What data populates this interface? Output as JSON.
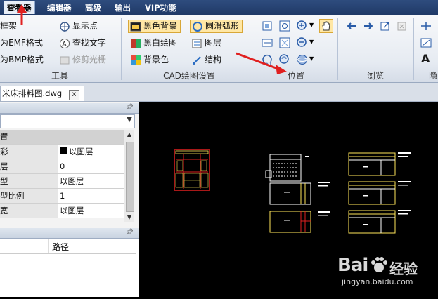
{
  "menu": {
    "items": [
      "查看器",
      "编辑器",
      "高级",
      "输出",
      "VIP功能"
    ]
  },
  "ribbon": {
    "tools": {
      "label": "工具",
      "frame": "框架",
      "emf": "为EMF格式",
      "bmp": "为BMP格式",
      "show_points": "显示点",
      "find_text": "查找文字",
      "trim_raster": "修剪光栅"
    },
    "cad_settings": {
      "label": "CAD绘图设置",
      "black_bg": "黑色背景",
      "smooth_arc": "圆滑弧形",
      "bw_drawing": "黑白绘图",
      "layers": "图层",
      "bg_color": "背景色",
      "structure": "结构"
    },
    "position": {
      "label": "位置"
    },
    "browse": {
      "label": "浏览"
    },
    "hidden": {
      "label": "隐"
    }
  },
  "tab": {
    "filename": "米床排料图.dwg",
    "close": "x"
  },
  "properties": {
    "rows": [
      {
        "key": "置",
        "value": ""
      },
      {
        "key": "彩",
        "value": "以图层"
      },
      {
        "key": "层",
        "value": "0"
      },
      {
        "key": "型",
        "value": "以图层"
      },
      {
        "key": "型比例",
        "value": "1"
      },
      {
        "key": "宽",
        "value": "以图层"
      }
    ]
  },
  "files": {
    "path_header": "路径"
  },
  "watermark": {
    "brand": "Bai",
    "brand2": "经验",
    "url": "jingyan.baidu.com"
  },
  "colors": {
    "menubar": "#1f3966",
    "accent_arrow": "#e02020",
    "drawing_red": "#e02020",
    "drawing_yellow": "#ffe65a"
  }
}
